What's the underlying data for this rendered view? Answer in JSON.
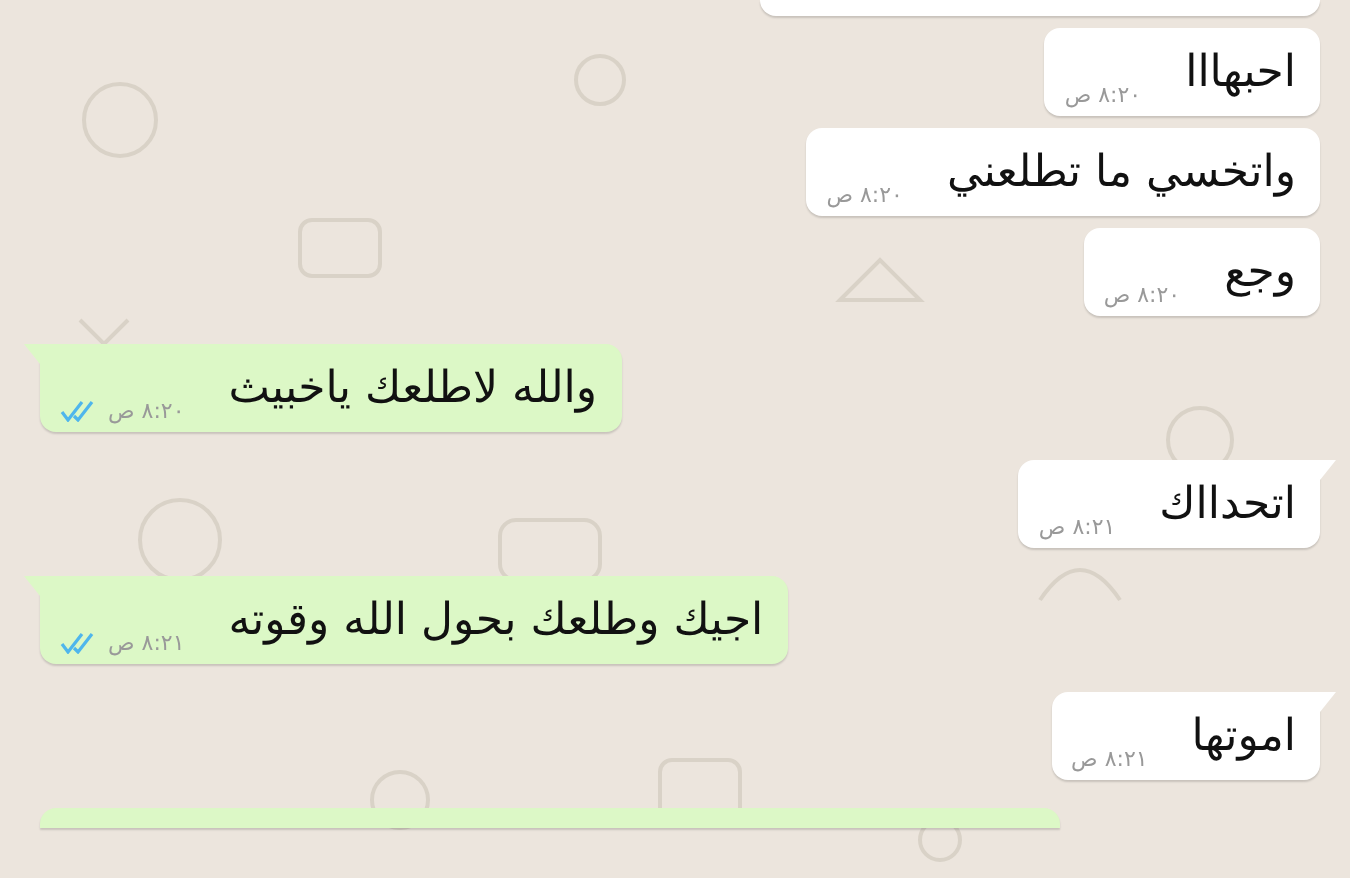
{
  "messages": [
    {
      "kind": "partial",
      "sent": false
    },
    {
      "kind": "text",
      "sent": false,
      "tail": false,
      "text": "احبهااا",
      "time": "٨:٢٠ ص"
    },
    {
      "kind": "text",
      "sent": false,
      "tail": false,
      "text": "واتخسي ما تطلعني",
      "time": "٨:٢٠ ص"
    },
    {
      "kind": "text",
      "sent": false,
      "tail": false,
      "text": "وجع",
      "time": "٨:٢٠ ص"
    },
    {
      "kind": "text",
      "sent": true,
      "tail": true,
      "text": "والله لاطلعك ياخبيث",
      "time": "٨:٢٠ ص",
      "read": true
    },
    {
      "kind": "text",
      "sent": false,
      "tail": true,
      "text": "اتحدااك",
      "time": "٨:٢١ ص"
    },
    {
      "kind": "text",
      "sent": true,
      "tail": true,
      "text": "اجيك وطلعك بحول الله وقوته",
      "time": "٨:٢١ ص",
      "read": true
    },
    {
      "kind": "text",
      "sent": false,
      "tail": true,
      "text": "اموتها",
      "time": "٨:٢١ ص"
    },
    {
      "kind": "partial",
      "sent": true
    }
  ]
}
